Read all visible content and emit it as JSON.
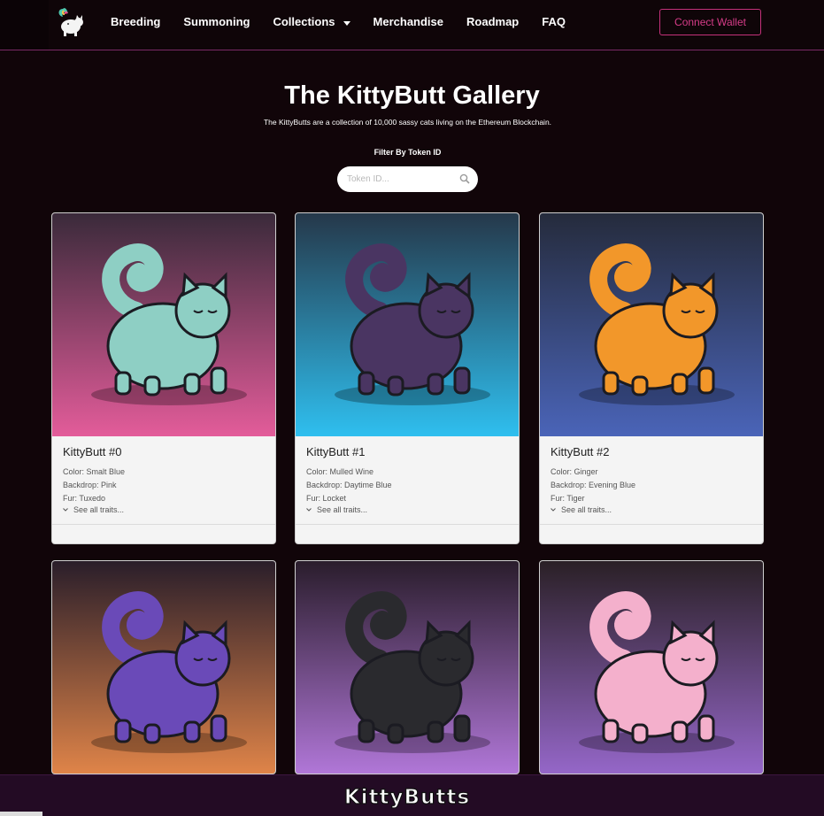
{
  "nav": {
    "links": [
      "Breeding",
      "Summoning",
      "Collections",
      "Merchandise",
      "Roadmap",
      "FAQ"
    ],
    "connect_label": "Connect Wallet"
  },
  "header": {
    "title": "The KittyButt Gallery",
    "subtitle": "The KittyButts are a collection of 10,000 sassy cats living on the Ethereum Blockchain.",
    "filter_label": "Filter By Token ID",
    "search_placeholder": "Token ID..."
  },
  "cards": [
    {
      "title": "KittyButt #0",
      "traits": [
        "Color: Smalt Blue",
        "Backdrop: Pink",
        "Fur: Tuxedo"
      ],
      "see_all": "See all traits...",
      "bg_top": "#3a2a3a",
      "bg_bottom": "#e35c9a",
      "cat_color": "#8ecfc4"
    },
    {
      "title": "KittyButt #1",
      "traits": [
        "Color: Mulled Wine",
        "Backdrop: Daytime Blue",
        "Fur: Locket"
      ],
      "see_all": "See all traits...",
      "bg_top": "#25384a",
      "bg_bottom": "#2fbfef",
      "cat_color": "#4a3562"
    },
    {
      "title": "KittyButt #2",
      "traits": [
        "Color: Ginger",
        "Backdrop: Evening Blue",
        "Fur: Tiger"
      ],
      "see_all": "See all traits...",
      "bg_top": "#252b3c",
      "bg_bottom": "#4a64b8",
      "cat_color": "#f2972a"
    },
    {
      "bg_top": "#2a1e2a",
      "bg_bottom": "#e8894a",
      "cat_color": "#6a4ab8"
    },
    {
      "bg_top": "#2a1d2c",
      "bg_bottom": "#b77be0",
      "cat_color": "#2a2a2e"
    },
    {
      "bg_top": "#2a2026",
      "bg_bottom": "#9a6ad0",
      "cat_color": "#f4b0cc"
    }
  ],
  "footer": {
    "brand": "KittyButts"
  },
  "colors": {
    "accent": "#d63c88",
    "nav_border": "#7a2a66",
    "background": "#110509"
  }
}
